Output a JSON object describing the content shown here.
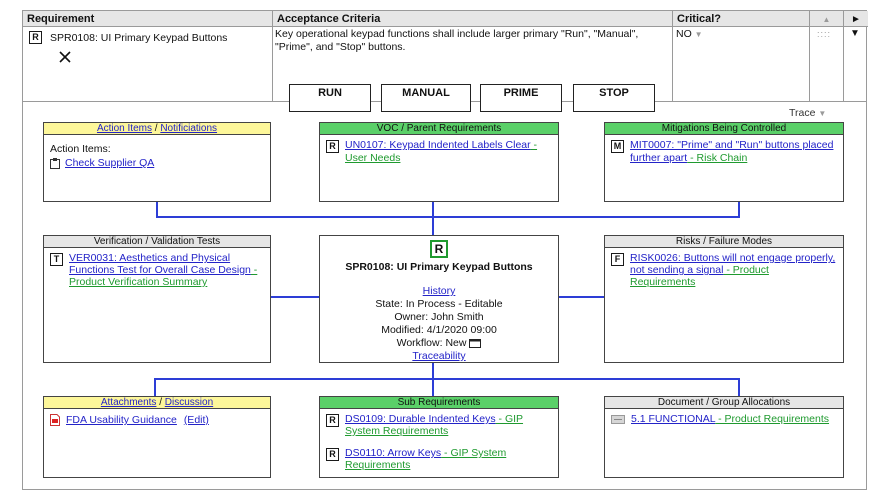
{
  "requirement_table": {
    "headers": {
      "requirement": "Requirement",
      "acceptance_criteria": "Acceptance Criteria",
      "critical": "Critical?"
    },
    "requirement": {
      "badge": "R",
      "id_title": "SPR0108: UI Primary Keypad Buttons"
    },
    "acceptance_text": "Key operational keypad functions shall include larger primary \"Run\", \"Manual\", \"Prime\", and \"Stop\" buttons.",
    "buttons": [
      "RUN",
      "MANUAL",
      "PRIME",
      "STOP"
    ],
    "critical_value": "NO"
  },
  "trace": {
    "label": "Trace",
    "action_items": {
      "title_a": "Action Items",
      "title_sep": " / ",
      "title_b": "Notificiations",
      "label": "Action Items:",
      "link": "Check Supplier QA"
    },
    "voc": {
      "title": "VOC / Parent Requirements",
      "badge": "R",
      "link": "UN0107: Keypad Indented Labels Clear",
      "link_suffix": " - User Needs"
    },
    "mitigations": {
      "title": "Mitigations Being Controlled",
      "badge": "M",
      "link": "MIT0007: \"Prime\" and \"Run\" buttons placed further apart",
      "link_suffix": " - Risk Chain"
    },
    "verification": {
      "title": "Verification / Validation Tests",
      "badge": "T",
      "link": "VER0031: Aesthetics and Physical Functions Test for Overall Case Design",
      "link_suffix": " - Product Verification Summary"
    },
    "center": {
      "badge": "R",
      "title": "SPR0108: UI Primary Keypad Buttons",
      "history": "History",
      "state": "State: In Process - Editable",
      "owner": "Owner: John Smith",
      "modified": "Modified: 4/1/2020 09:00",
      "workflow": "Workflow: New",
      "traceability": "Traceability"
    },
    "risks": {
      "title": "Risks / Failure Modes",
      "badge": "F",
      "link": "RISK0026: Buttons will not engage properly, not sending a signal",
      "link_suffix": " - Product Requirements"
    },
    "attachments": {
      "title_a": "Attachments",
      "title_sep": " / ",
      "title_b": "Discussion",
      "link": "FDA Usability Guidance",
      "edit": "(Edit)"
    },
    "sub_requirements": {
      "title": "Sub Requirements",
      "items": [
        {
          "badge": "R",
          "link": "DS0109: Durable Indented Keys",
          "suffix": " - GIP System Requirements"
        },
        {
          "badge": "R",
          "link": "DS0110: Arrow Keys",
          "suffix": " - GIP System Requirements"
        }
      ]
    },
    "document": {
      "title": "Document / Group Allocations",
      "link": "5.1 FUNCTIONAL",
      "suffix": " - Product Requirements"
    }
  },
  "colors": {
    "link_blue": "#2323c8",
    "link_green": "#1f9a2f",
    "connector": "#2d3ed6",
    "title_yellow": "#fdf79a",
    "title_green": "#5ad068",
    "title_gray": "#e6e6e6"
  }
}
